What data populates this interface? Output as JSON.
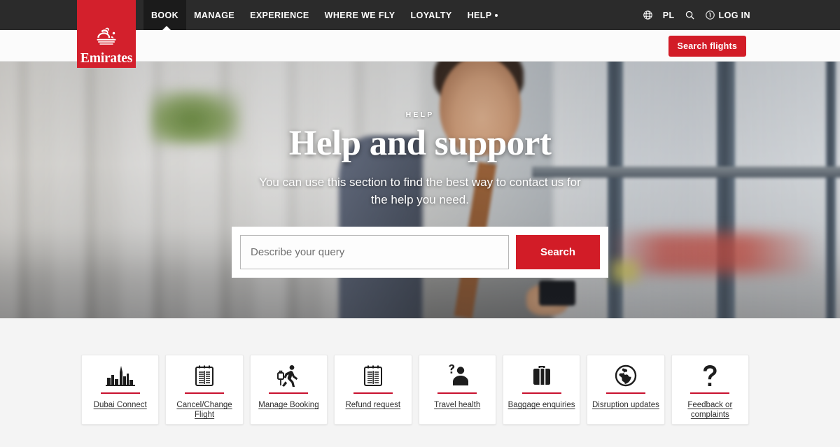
{
  "brand": {
    "name": "Emirates",
    "logo_icon": "emirates-calligraphy-logo",
    "red": "#d3202c",
    "accent_red": "#d21c27",
    "rule_red": "#c8102e"
  },
  "topnav": {
    "items": [
      {
        "label": "BOOK",
        "active": true,
        "has_dot": false
      },
      {
        "label": "MANAGE",
        "active": false,
        "has_dot": false
      },
      {
        "label": "EXPERIENCE",
        "active": false,
        "has_dot": false
      },
      {
        "label": "WHERE WE FLY",
        "active": false,
        "has_dot": false
      },
      {
        "label": "LOYALTY",
        "active": false,
        "has_dot": false
      },
      {
        "label": "HELP",
        "active": false,
        "has_dot": true
      }
    ],
    "utilities": {
      "globe_icon": "globe-icon",
      "language": "PL",
      "search_icon": "search-icon",
      "account_icon": "account-circle-icon",
      "login_label": "LOG IN"
    }
  },
  "subbar": {
    "search_flights_label": "Search flights"
  },
  "hero": {
    "eyebrow": "HELP",
    "title": "Help and support",
    "subtitle": "You can use this section to find the best way to contact us for the help you need.",
    "search": {
      "placeholder": "Describe your query",
      "value": "",
      "button_label": "Search"
    }
  },
  "quick_links": {
    "items": [
      {
        "label": "Dubai Connect",
        "icon": "burj-khalifa-skyline-icon"
      },
      {
        "label": "Cancel/Change Flight",
        "icon": "document-list-icon"
      },
      {
        "label": "Manage Booking",
        "icon": "traveller-with-luggage-icon"
      },
      {
        "label": "Refund request",
        "icon": "receipt-document-icon"
      },
      {
        "label": "Travel health",
        "icon": "person-question-mark-icon"
      },
      {
        "label": "Baggage enquiries",
        "icon": "suitcase-icon"
      },
      {
        "label": "Disruption updates",
        "icon": "globe-icon"
      },
      {
        "label": "Feedback or complaints",
        "icon": "question-mark-icon"
      }
    ]
  }
}
